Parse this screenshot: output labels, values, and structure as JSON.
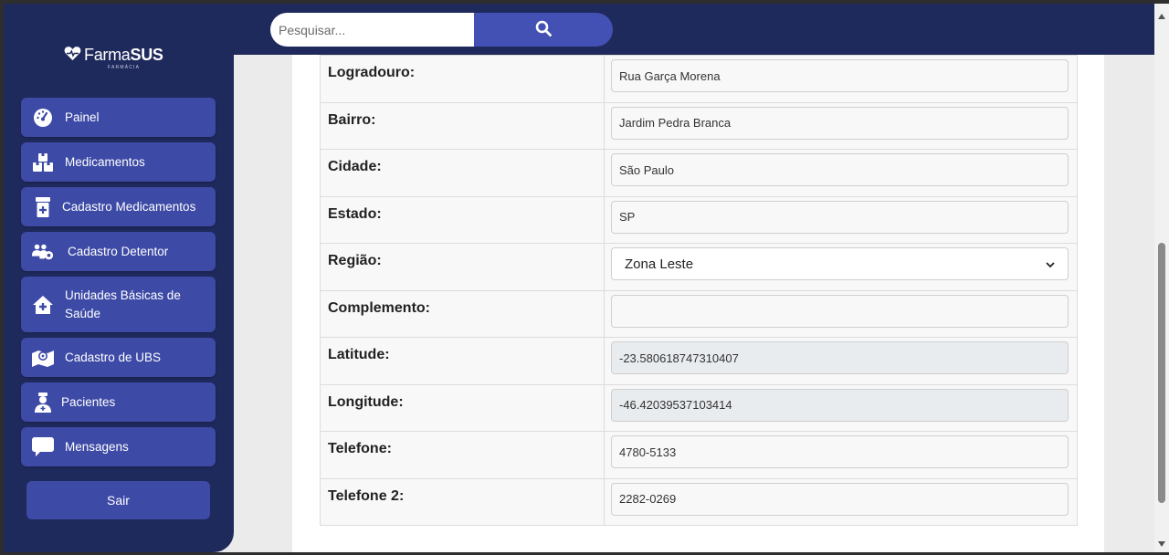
{
  "app": {
    "logo_text_light": "Farma",
    "logo_text_bold": "SUS",
    "logo_tagline": "FARMÁCIA"
  },
  "sidebar": {
    "items": [
      {
        "label": "Painel",
        "icon": "gauge-icon"
      },
      {
        "label": "Medicamentos",
        "icon": "boxes-icon"
      },
      {
        "label": "Cadastro Medicamentos",
        "icon": "prescription-bottle-icon"
      },
      {
        "label": "Cadastro Detentor",
        "icon": "users-gear-icon"
      },
      {
        "label": "Unidades Básicas de Saúde",
        "icon": "house-medical-icon"
      },
      {
        "label": "Cadastro de UBS",
        "icon": "map-location-icon"
      },
      {
        "label": "Pacientes",
        "icon": "user-nurse-icon"
      },
      {
        "label": "Mensagens",
        "icon": "message-icon"
      }
    ],
    "logout_label": "Sair"
  },
  "search": {
    "placeholder": "Pesquisar...",
    "icon": "search-icon"
  },
  "form": {
    "logradouro": {
      "label": "Logradouro:",
      "value": "Rua Garça Morena"
    },
    "bairro": {
      "label": "Bairro:",
      "value": "Jardim Pedra Branca"
    },
    "cidade": {
      "label": "Cidade:",
      "value": "São Paulo"
    },
    "estado": {
      "label": "Estado:",
      "value": "SP"
    },
    "regiao": {
      "label": "Região:",
      "value": "Zona Leste"
    },
    "complemento": {
      "label": "Complemento:",
      "value": ""
    },
    "latitude": {
      "label": "Latitude:",
      "value": "-23.580618747310407"
    },
    "longitude": {
      "label": "Longitude:",
      "value": "-46.42039537103414"
    },
    "telefone": {
      "label": "Telefone:",
      "value": "4780-5133"
    },
    "telefone2": {
      "label": "Telefone 2:",
      "value": "2282-0269"
    }
  },
  "colors": {
    "navy": "#1f2a5c",
    "nav_button": "#3d4aa6",
    "search_button": "#4351b5"
  }
}
